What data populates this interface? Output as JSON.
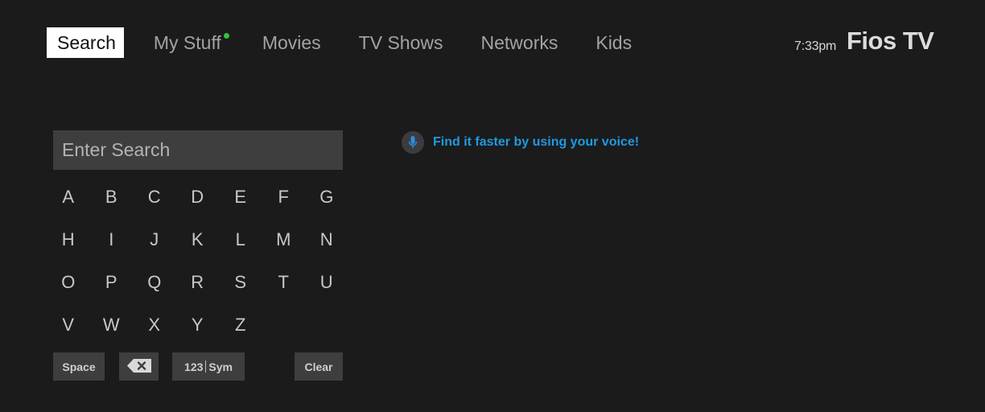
{
  "nav": {
    "items": [
      {
        "label": "Search",
        "active": true
      },
      {
        "label": "My Stuff",
        "has_notification_dot": true
      },
      {
        "label": "Movies"
      },
      {
        "label": "TV Shows"
      },
      {
        "label": "Networks"
      },
      {
        "label": "Kids"
      }
    ]
  },
  "header": {
    "time": "7:33pm",
    "brand": "Fios TV"
  },
  "search": {
    "placeholder": "Enter Search",
    "value": ""
  },
  "keyboard": {
    "rows": [
      [
        "A",
        "B",
        "C",
        "D",
        "E",
        "F",
        "G"
      ],
      [
        "H",
        "I",
        "J",
        "K",
        "L",
        "M",
        "N"
      ],
      [
        "O",
        "P",
        "Q",
        "R",
        "S",
        "T",
        "U"
      ],
      [
        "V",
        "W",
        "X",
        "Y",
        "Z"
      ]
    ],
    "space_label": "Space",
    "backspace_icon": "backspace-icon",
    "numsym_label_left": "123",
    "numsym_label_right": "Sym",
    "clear_label": "Clear"
  },
  "voice": {
    "icon": "microphone-icon",
    "text": "Find it faster by using your voice!"
  },
  "colors": {
    "background": "#1b1b1c",
    "active_tab_bg": "#ffffff",
    "notification_dot": "#2fc23d",
    "voice_text": "#1e9be0",
    "key_bg": "#3e3e3f"
  }
}
